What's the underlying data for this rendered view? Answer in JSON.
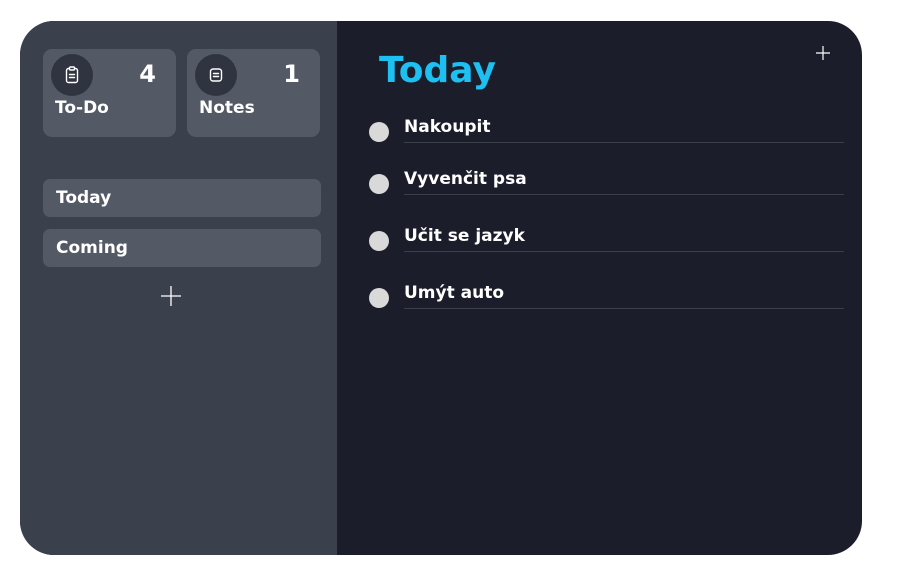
{
  "sidebar": {
    "cards": [
      {
        "icon": "clipboard-icon",
        "count": "4",
        "label": "To-Do"
      },
      {
        "icon": "note-icon",
        "count": "1",
        "label": "Notes"
      }
    ],
    "lists": [
      {
        "label": "Today"
      },
      {
        "label": "Coming"
      }
    ],
    "add_icon": "plus-icon"
  },
  "main": {
    "title": "Today",
    "add_icon": "plus-icon",
    "tasks": [
      {
        "label": "Nakoupit"
      },
      {
        "label": "Vyvenčit psa"
      },
      {
        "label": "Učit se jazyk"
      },
      {
        "label": "Umýt auto"
      }
    ]
  },
  "colors": {
    "sidebar_bg": "#3b404d",
    "card_bg": "#545966",
    "main_bg": "#1b1e2a",
    "accent": "#1ec0f2",
    "checkbox": "#d9d9d9"
  }
}
